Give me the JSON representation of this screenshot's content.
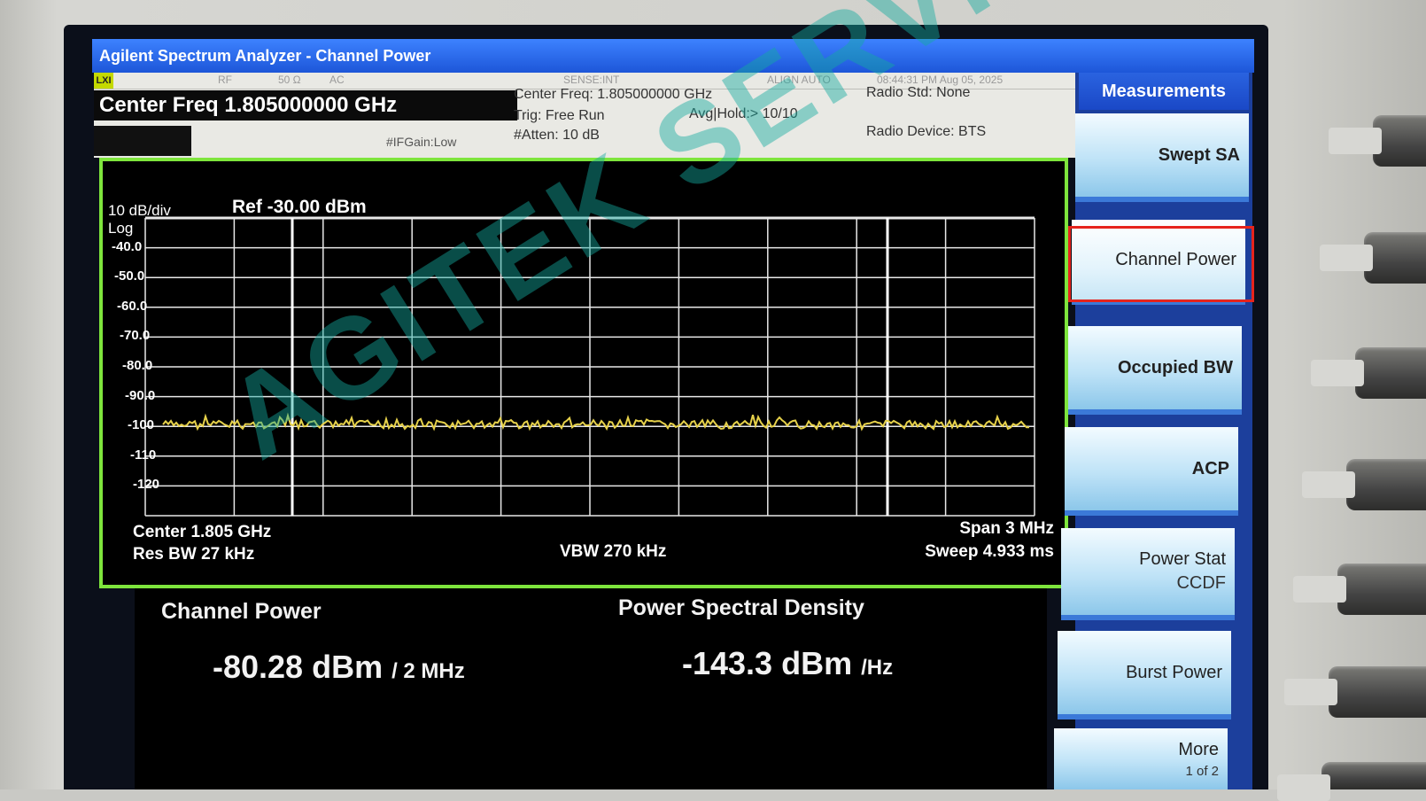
{
  "window": {
    "title": "Agilent Spectrum Analyzer - Channel Power"
  },
  "status": {
    "lxi": "LXI",
    "rf": "RF",
    "impedance": "50 Ω",
    "coupling": "AC",
    "sense": "SENSE:INT",
    "align": "ALIGN AUTO",
    "datetime": "08:44:31 PM Aug 05, 2025"
  },
  "header": {
    "center_freq_box": "Center Freq 1.805000000 GHz",
    "if_gain": "#IFGain:Low",
    "center_freq": "Center Freq: 1.805000000 GHz",
    "trig": "Trig: Free Run",
    "avg_hold": "Avg|Hold:> 10/10",
    "atten": "#Atten: 10 dB",
    "radio_std": "Radio Std: None",
    "radio_device": "Radio Device: BTS"
  },
  "graph": {
    "scale": "10 dB/div",
    "log": "Log",
    "ref": "Ref -30.00 dBm",
    "yticks": [
      "-40.0",
      "-50.0",
      "-60.0",
      "-70.0",
      "-80.0",
      "-90.0",
      "-100",
      "-110",
      "-120"
    ],
    "center": "Center  1.805 GHz",
    "res_bw": "Res BW  27 kHz",
    "vbw": "VBW  270 kHz",
    "span": "Span 3 MHz",
    "sweep": "Sweep  4.933 ms",
    "trace_color": "#e6d14a",
    "grid_color": "#e8e8e8",
    "frame_color": "#7ee53c"
  },
  "results": {
    "channel_power_label": "Channel Power",
    "channel_power_value": "-80.28 dBm",
    "channel_power_unit": "/ 2 MHz",
    "psd_label": "Power Spectral Density",
    "psd_value": "-143.3 dBm",
    "psd_unit": "/Hz"
  },
  "softkeys": {
    "header": "Measurements",
    "items": [
      "Swept SA",
      "Channel Power",
      "Occupied BW",
      "ACP",
      "Power Stat",
      "Burst Power",
      "More"
    ],
    "power_stat_sub": "CCDF",
    "more_sub": "1 of 2",
    "selected": "Channel Power"
  },
  "watermark": "AGITEK SERVICE"
}
